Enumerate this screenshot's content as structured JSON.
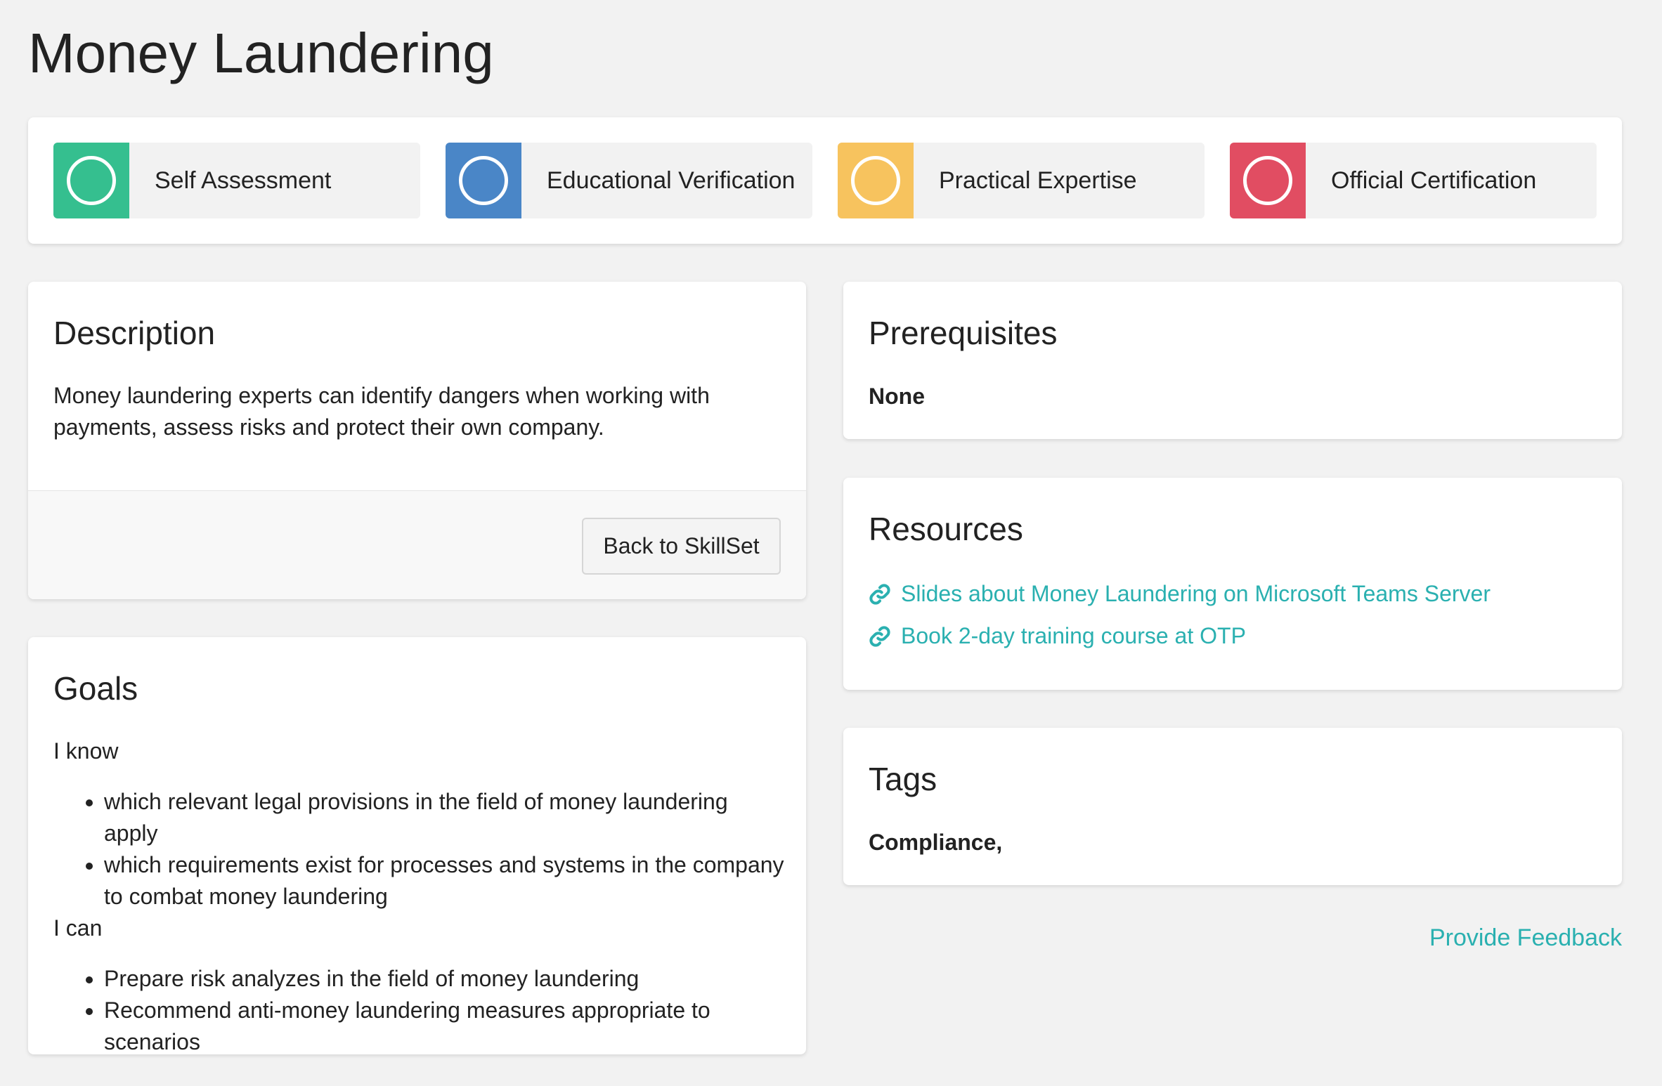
{
  "page": {
    "title": "Money Laundering"
  },
  "status": {
    "items": [
      {
        "label": "Self Assessment",
        "color": "#35bf8f",
        "icon": "circle-outline-icon"
      },
      {
        "label": "Educational Verification",
        "color": "#4a86c7",
        "icon": "circle-outline-icon"
      },
      {
        "label": "Practical Expertise",
        "color": "#f7c35e",
        "icon": "circle-outline-icon"
      },
      {
        "label": "Official Certification",
        "color": "#e14d62",
        "icon": "circle-outline-icon"
      }
    ]
  },
  "description": {
    "heading": "Description",
    "text": "Money laundering experts can identify dangers when working with payments, assess risks and protect their own company.",
    "back_label": "Back to SkillSet"
  },
  "goals": {
    "heading": "Goals",
    "know_label": "I know",
    "know_items": [
      "which relevant legal provisions in the field of money laundering apply",
      "which requirements exist for processes and systems in the company to combat money laundering"
    ],
    "can_label": "I can",
    "can_items": [
      "Prepare risk analyzes in the field of money laundering",
      "Recommend anti-money laundering measures appropriate to scenarios"
    ]
  },
  "prerequisites": {
    "heading": "Prerequisites",
    "value": "None"
  },
  "resources": {
    "heading": "Resources",
    "links": [
      {
        "label": "Slides about Money Laundering on Microsoft Teams Server",
        "icon": "link-icon"
      },
      {
        "label": "Book 2-day training course at OTP",
        "icon": "link-icon"
      }
    ]
  },
  "tags": {
    "heading": "Tags",
    "value": "Compliance,"
  },
  "feedback": {
    "label": "Provide Feedback"
  },
  "colors": {
    "link": "#2ab0b0",
    "background": "#f2f2f2"
  }
}
